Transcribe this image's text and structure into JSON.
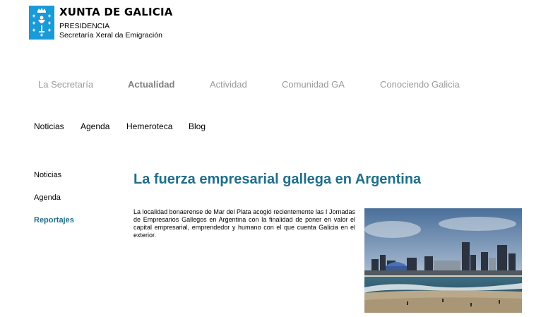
{
  "header": {
    "brand_title": "XUNTA DE GALICIA",
    "brand_sub1": "PRESIDENCIA",
    "brand_sub2": "Secretaría Xeral da Emigración",
    "logo_color": "#1a9ad6"
  },
  "main_nav": {
    "items": [
      {
        "label": "La Secretaría"
      },
      {
        "label": "Actualidad",
        "active": true
      },
      {
        "label": "Actividad"
      },
      {
        "label": "Comunidad GA"
      },
      {
        "label": "Conociendo Galicia"
      }
    ],
    "text_color": "#9a9a9a"
  },
  "sub_nav": {
    "items": [
      {
        "label": "Noticias"
      },
      {
        "label": "Agenda"
      },
      {
        "label": "Hemeroteca"
      },
      {
        "label": "Blog"
      }
    ]
  },
  "side_menu": {
    "items": [
      {
        "label": "Noticias"
      },
      {
        "label": "Agenda"
      },
      {
        "label": "Reportajes",
        "active": true
      }
    ],
    "active_color": "#1f6f8b"
  },
  "article": {
    "title": "La fuerza empresarial gallega en Argentina",
    "body": "La localidad bonaerense de Mar del Plata acogió recientemente las I Jornadas de Empresarios Gallegos en Argentina con la finalidad de poner en valor el capital empresarial, emprendedor y humano con el que cuenta Galicia en el exterior.",
    "title_color": "#1f6f8b"
  }
}
